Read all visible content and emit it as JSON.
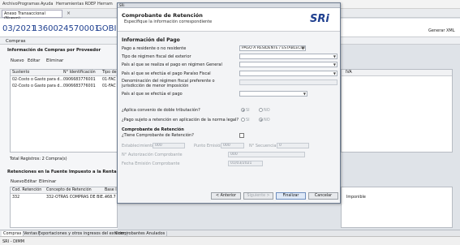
{
  "menu": [
    "Archivo",
    "Programas",
    "Ayuda",
    "Herramientas RDEP",
    "Herram"
  ],
  "tabs": {
    "anexo": "Anexo Transaccional (Nuevo)",
    "close": "×"
  },
  "header": {
    "period": "03/2021",
    "ruc": "1360024570001",
    "company": "GOBIERNO",
    "generate_xml": "Generar XML"
  },
  "compras_tab": "Compras",
  "compras": {
    "title": "Información de Compras por Proveedor",
    "actions": [
      "Nuevo",
      "Editar",
      "Eliminar"
    ],
    "columns": [
      "Sustento",
      "N° Identificación",
      "Tipo de"
    ],
    "rows": [
      [
        "02-Costo o Gasto para d...",
        "0906683776001",
        "01-FAC"
      ],
      [
        "02-Costo o Gasto para d...",
        "0906683776001",
        "01-FAC"
      ]
    ],
    "total": "Total Registros: 2 Compra(s)",
    "right_col": "IVA"
  },
  "retenciones": {
    "title": "Retenciones en la Fuente  Impuesto a la Renta",
    "actions": [
      "Nuevo",
      "Editar",
      "Eliminar"
    ],
    "columns": [
      "Cod. Retención",
      "Concepto de Retención",
      "Base I"
    ],
    "rows": [
      [
        "332",
        "332-OTRAS COMPRAS DE BIE...",
        "468.7"
      ]
    ],
    "right_value": "Imponible"
  },
  "bottom_tabs": [
    "Compras",
    "Ventas",
    "Exportaciones y otros ingresos del exterior",
    "Comprobantes Anulados"
  ],
  "status": "SRI - DIMM",
  "dialog": {
    "titlebar": "SRi",
    "title": "Comprobante de Retención",
    "subtitle": "Especifique la información correspondiente",
    "logo": "SRi",
    "pago_section": "Información del Pago",
    "labels": {
      "pago_residente": "Pago a residente o no residente",
      "tipo_regimen": "Tipo de régimen fiscal del exterior",
      "pais_regimen_general": "País al que se realiza el pago en régimen General",
      "pais_paraiso": "País al que se efectúa el pago Paraíso Fiscal",
      "denominacion": "Denominación del régimen fiscal preferente o jurisdicción de menor imposición",
      "pais_efectua": "País al que se efectúa el pago",
      "convenio": "¿Aplica convenio de doble tributación?",
      "sujeto_retencion": "¿Pago sujeto a retención en aplicación de la norma legal?",
      "si": "SI",
      "no": "NO"
    },
    "pago_residente_value": "PAGO A RESIDENTE / ESTABLECIM",
    "comprobante_section": "Comprobante de Retención",
    "tiene_comprobante": "¿Tiene Comprobante de Retención?",
    "establecimiento_label": "Establecimiento",
    "establecimiento_value": "000",
    "punto_emision_label": "Punto Emisión",
    "punto_emision_value": "000",
    "secuencial_label": "N° Secuencial",
    "secuencial_value": "0",
    "autorizacion_label": "N° Autorización Comprobante",
    "autorizacion_value": "000",
    "fecha_label": "Fecha Emisión Comprobante",
    "fecha_value": "01/03/2021",
    "buttons": {
      "anterior": "< Anterior",
      "siguiente": "Siguiente >",
      "finalizar": "Finalizar",
      "cancelar": "Cancelar"
    }
  }
}
